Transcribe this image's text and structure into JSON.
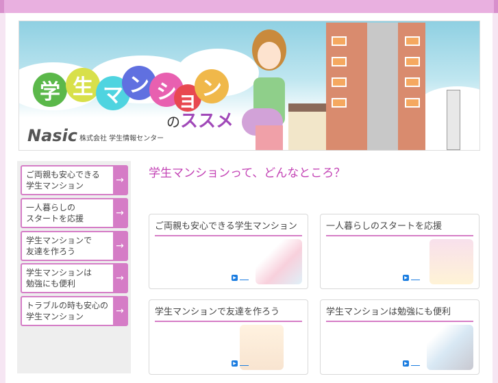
{
  "banner": {
    "title_chars": [
      "学",
      "生",
      "マ",
      "ン",
      "シ",
      "ョ",
      "ン"
    ],
    "circle_colors": [
      "#5bb84a",
      "#d8e04a",
      "#4fd4e0",
      "#6070e0",
      "#e860b0",
      "#e84850",
      "#f0b84a"
    ],
    "subtitle_no": "の",
    "subtitle": "ススメ",
    "logo": "Nasic",
    "company": "株式会社 学生情報センター"
  },
  "sidebar": {
    "items": [
      {
        "label": "ご両親も安心できる\n学生マンション"
      },
      {
        "label": "一人暮らしの\nスタートを応援"
      },
      {
        "label": "学生マンションで\n友達を作ろう"
      },
      {
        "label": "学生マンションは\n勉強にも便利"
      },
      {
        "label": "トラブルの時も安心の\n学生マンション"
      }
    ],
    "arrow": "→"
  },
  "main": {
    "title": "学生マンションって、どんなところ？",
    "cards": [
      {
        "title": "ご両親も安心できる学生マンション"
      },
      {
        "title": "一人暮らしのスタートを応援"
      },
      {
        "title": "学生マンションで友達を作ろう"
      },
      {
        "title": "学生マンションは勉強にも便利"
      }
    ]
  }
}
